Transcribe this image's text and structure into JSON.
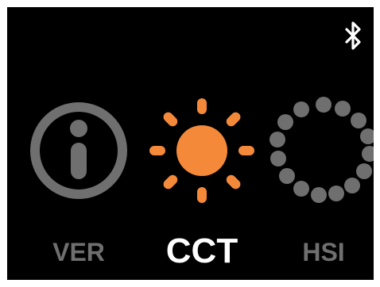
{
  "status_bar": {
    "bluetooth_icon": "bluetooth-icon"
  },
  "modes": [
    {
      "id": "ver",
      "label": "VER",
      "icon": "info-icon",
      "selected": false
    },
    {
      "id": "cct",
      "label": "CCT",
      "icon": "sun-icon",
      "selected": true
    },
    {
      "id": "hsi",
      "label": "HSI",
      "icon": "dotted-ring-icon",
      "selected": false
    }
  ],
  "colors": {
    "background": "#000000",
    "selected_icon": "#f5893a",
    "inactive_icon": "#6f6f6f",
    "selected_label": "#ffffff",
    "inactive_label": "#6f6f6f"
  }
}
